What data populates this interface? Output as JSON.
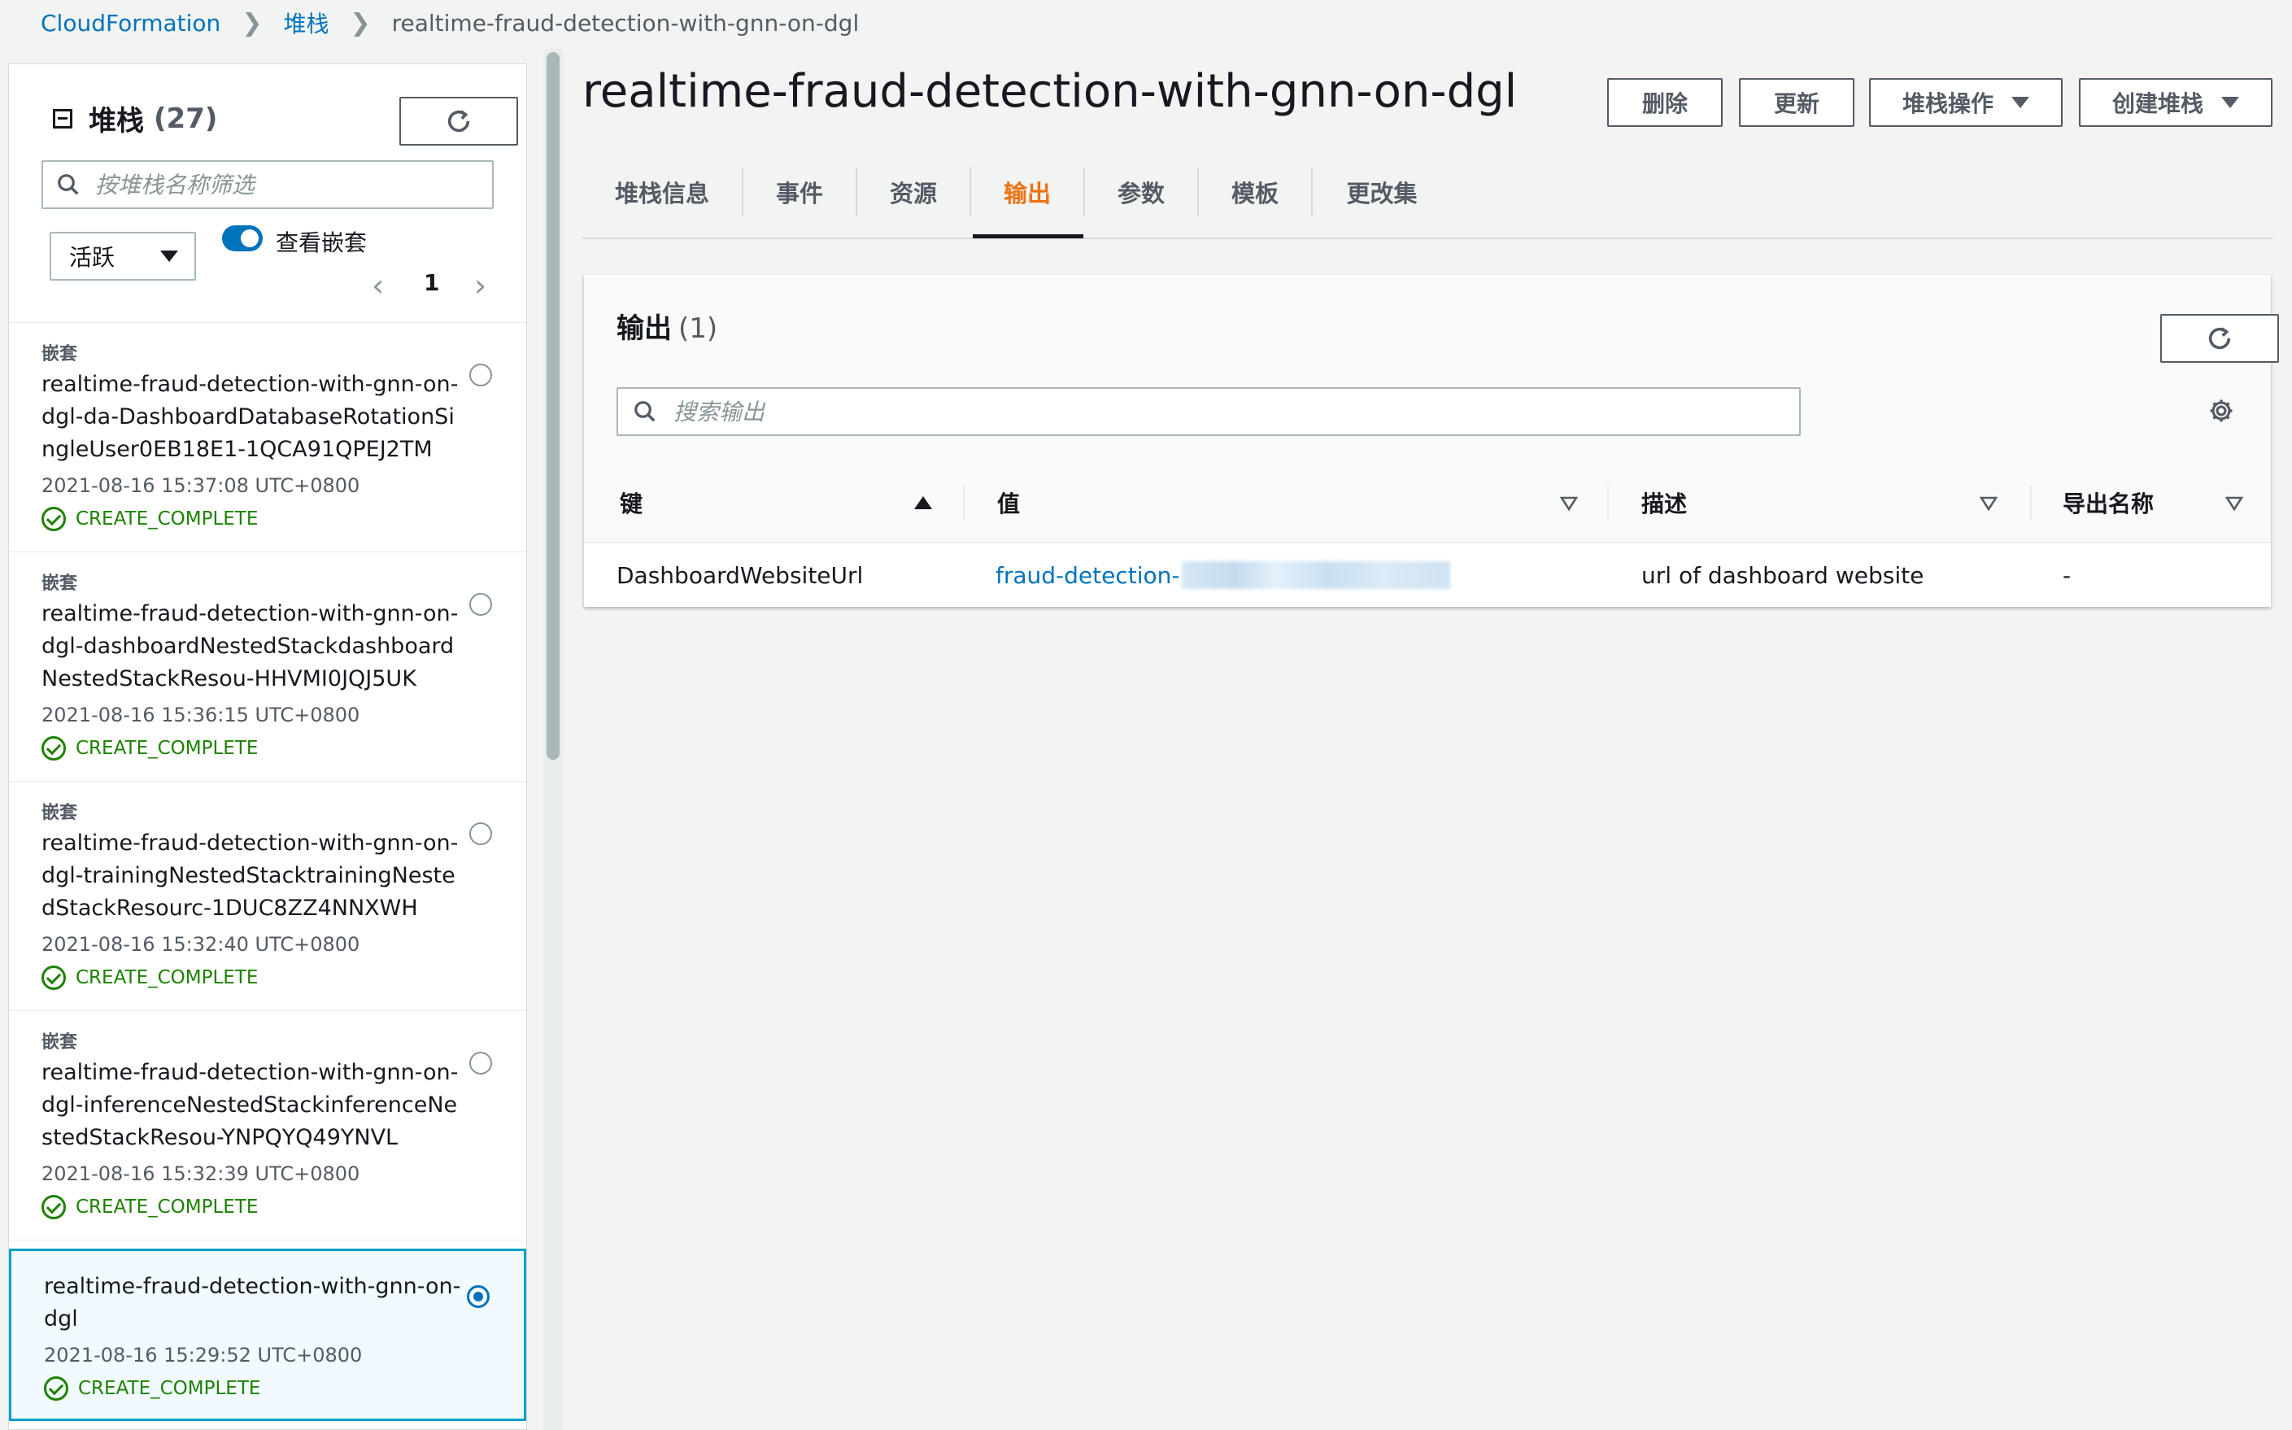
{
  "breadcrumb": {
    "items": [
      "CloudFormation",
      "堆栈"
    ],
    "current": "realtime-fraud-detection-with-gnn-on-dgl"
  },
  "stacks_panel": {
    "title": "堆栈",
    "count": "(27)",
    "filter_placeholder": "按堆栈名称筛选",
    "status_select": "活跃",
    "toggle_label": "查看嵌套",
    "page": "1",
    "items": [
      {
        "nested_label": "嵌套",
        "name": "realtime-fraud-detection-with-gnn-on-dgl-da-DashboardDatabaseRotationSingleUser0EB18E1-1QCA91QPEJ2TM",
        "date": "2021-08-16 15:37:08 UTC+0800",
        "status": "CREATE_COMPLETE"
      },
      {
        "nested_label": "嵌套",
        "name": "realtime-fraud-detection-with-gnn-on-dgl-dashboardNestedStackdashboardNestedStackResou-HHVMI0JQJ5UK",
        "date": "2021-08-16 15:36:15 UTC+0800",
        "status": "CREATE_COMPLETE"
      },
      {
        "nested_label": "嵌套",
        "name": "realtime-fraud-detection-with-gnn-on-dgl-trainingNestedStacktrainingNestedStackResourc-1DUC8ZZ4NNXWH",
        "date": "2021-08-16 15:32:40 UTC+0800",
        "status": "CREATE_COMPLETE"
      },
      {
        "nested_label": "嵌套",
        "name": "realtime-fraud-detection-with-gnn-on-dgl-inferenceNestedStackinferenceNestedStackResou-YNPQYQ49YNVL",
        "date": "2021-08-16 15:32:39 UTC+0800",
        "status": "CREATE_COMPLETE"
      },
      {
        "nested_label": "",
        "name": "realtime-fraud-detection-with-gnn-on-dgl",
        "date": "2021-08-16 15:29:52 UTC+0800",
        "status": "CREATE_COMPLETE"
      }
    ]
  },
  "main": {
    "title": "realtime-fraud-detection-with-gnn-on-dgl",
    "actions": {
      "delete": "删除",
      "update": "更新",
      "stack_actions": "堆栈操作",
      "create_stack": "创建堆栈"
    },
    "tabs": [
      "堆栈信息",
      "事件",
      "资源",
      "输出",
      "参数",
      "模板",
      "更改集"
    ],
    "active_tab": "输出"
  },
  "outputs": {
    "title": "输出",
    "count": "(1)",
    "search_placeholder": "搜索输出",
    "columns": [
      "键",
      "值",
      "描述",
      "导出名称"
    ],
    "rows": [
      {
        "key": "DashboardWebsiteUrl",
        "value": "fraud-detection-",
        "description": "url of dashboard website",
        "export_name": "-"
      }
    ]
  },
  "colors": {
    "link": "#0073bb",
    "active_tab": "#ec7211",
    "success": "#1d8102",
    "selected_border": "#00a1c9"
  }
}
